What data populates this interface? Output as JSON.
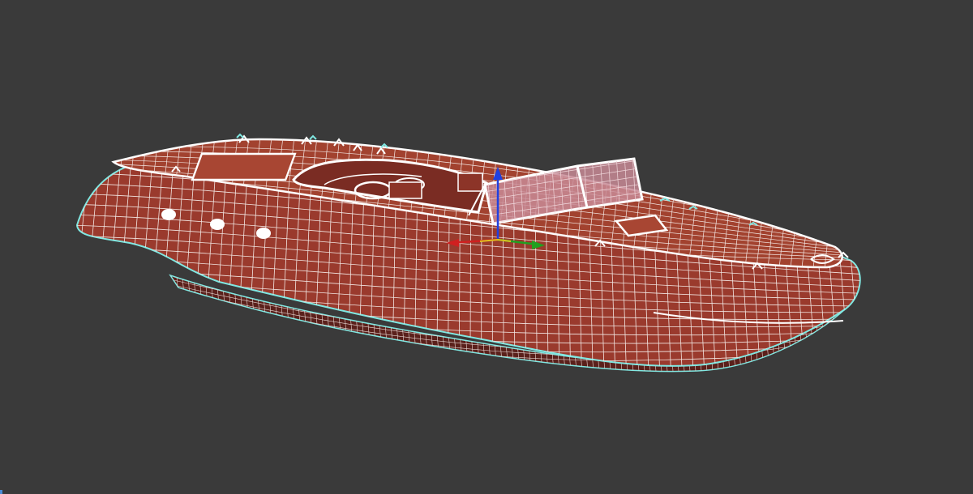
{
  "viewport": {
    "shading_mode": "wireframe-on-shaded",
    "background_color": "#3a3a3a"
  },
  "model": {
    "type": "speedboat",
    "hull_color": "#9a3a2d",
    "hull_dark_color": "#6d2620",
    "wire_color": "#ffffff",
    "selection_outline_color": "#7fe8e2",
    "windshield_color": "#c88a95"
  },
  "gizmo": {
    "axis_x_color": "#d02020",
    "axis_y_color": "#20a020",
    "axis_z_color": "#2040e0",
    "plane_color": "#e0c020"
  }
}
